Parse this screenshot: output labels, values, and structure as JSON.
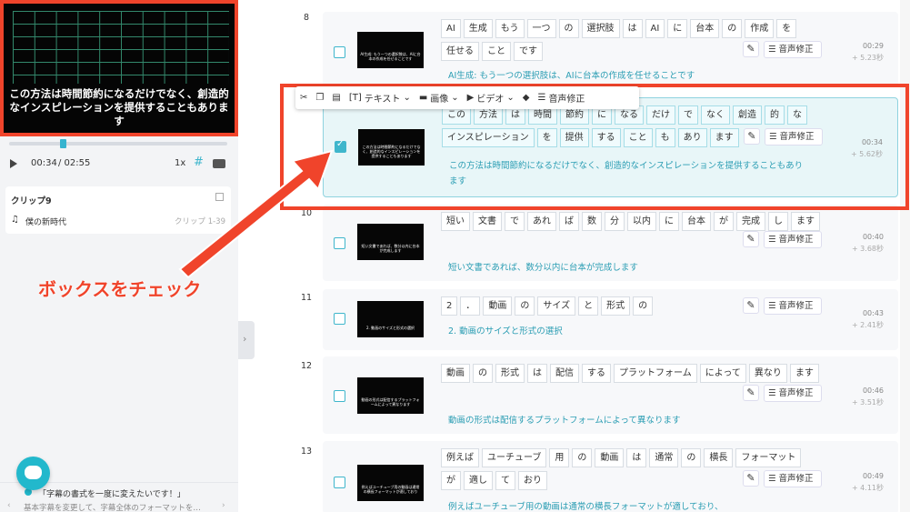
{
  "player": {
    "caption": "この方法は時間節約になるだけでなく、創造的なインスピレーションを提供することもあります",
    "current_time": "00:34",
    "total_time": "/ 02:55",
    "speed": "1x"
  },
  "clip": {
    "title": "クリップ9",
    "track": "僕の新時代",
    "range": "クリップ 1-39"
  },
  "help": {
    "title": "「字幕の書式を一度に変えたいです！」",
    "body": "基本字幕を変更して、字幕全体のフォーマットを…"
  },
  "toolbar": {
    "text": "テキスト",
    "image": "画像",
    "video": "ビデオ",
    "voice_fix": "音声修正"
  },
  "callout": "ボックスをチェック",
  "voice_fix_label": "音声修正",
  "rows": [
    {
      "num": "8",
      "tokens": [
        "AI",
        "生成",
        "もう",
        "一つ",
        "の",
        "選択肢",
        "は",
        "AI",
        "に",
        "台本",
        "の",
        "作成",
        "を",
        "任せる",
        "こと",
        "です"
      ],
      "sentence": "AI生成: もう一つの選択肢は、AIに台本の作成を任せることです",
      "time": "00:29",
      "duration": "+ 5.23秒",
      "checked": false,
      "thumb_text": "AI生成: もう一つの選択肢は、AIに台本の作成を任せることです"
    },
    {
      "num": "9",
      "tokens": [
        "この",
        "方法",
        "は",
        "時間",
        "節約",
        "に",
        "なる",
        "だけ",
        "で",
        "なく",
        "創造",
        "的",
        "な",
        "インスピレーション",
        "を",
        "提供",
        "する",
        "こと",
        "も",
        "あり",
        "ます"
      ],
      "sentence": "この方法は時間節約になるだけでなく、創造的なインスピレーションを提供することもあり ます",
      "time": "00:34",
      "duration": "+ 5.62秒",
      "checked": true,
      "thumb_text": "この方法は時間節約になるだけでなく、創造的なインスピレーションを提供することもあります"
    },
    {
      "num": "10",
      "tokens": [
        "短い",
        "文書",
        "で",
        "あれ",
        "ば",
        "数",
        "分",
        "以内",
        "に",
        "台本",
        "が",
        "完成",
        "し",
        "ます"
      ],
      "sentence": "短い文書であれば、数分以内に台本が完成します",
      "time": "00:40",
      "duration": "+ 3.68秒",
      "checked": false,
      "thumb_text": "短い文書であれば、数分以内に台本が完成します"
    },
    {
      "num": "11",
      "tokens": [
        "2",
        "．",
        "動画",
        "の",
        "サイズ",
        "と",
        "形式",
        "の"
      ],
      "sentence": "2. 動画のサイズと形式の選択",
      "time": "00:43",
      "duration": "+ 2.41秒",
      "checked": false,
      "thumb_text": "2. 動画のサイズと形式の選択"
    },
    {
      "num": "12",
      "tokens": [
        "動画",
        "の",
        "形式",
        "は",
        "配信",
        "する",
        "プラットフォーム",
        "によって",
        "異なり",
        "ます"
      ],
      "sentence": "動画の形式は配信するプラットフォームによって異なります",
      "time": "00:46",
      "duration": "+ 3.51秒",
      "checked": false,
      "thumb_text": "動画の形式は配信するプラットフォームによって異なります"
    },
    {
      "num": "13",
      "tokens": [
        "例えば",
        "ユーチューブ",
        "用",
        "の",
        "動画",
        "は",
        "通常",
        "の",
        "横長",
        "フォーマット",
        "が",
        "適し",
        "て",
        "おり"
      ],
      "sentence": "例えばユーチューブ用の動画は通常の横長フォーマットが適しており、",
      "time": "00:49",
      "duration": "+ 4.11秒",
      "checked": false,
      "thumb_text": "例えばユーチューブ用の動画は通常の横長フォーマットが適しており"
    }
  ]
}
